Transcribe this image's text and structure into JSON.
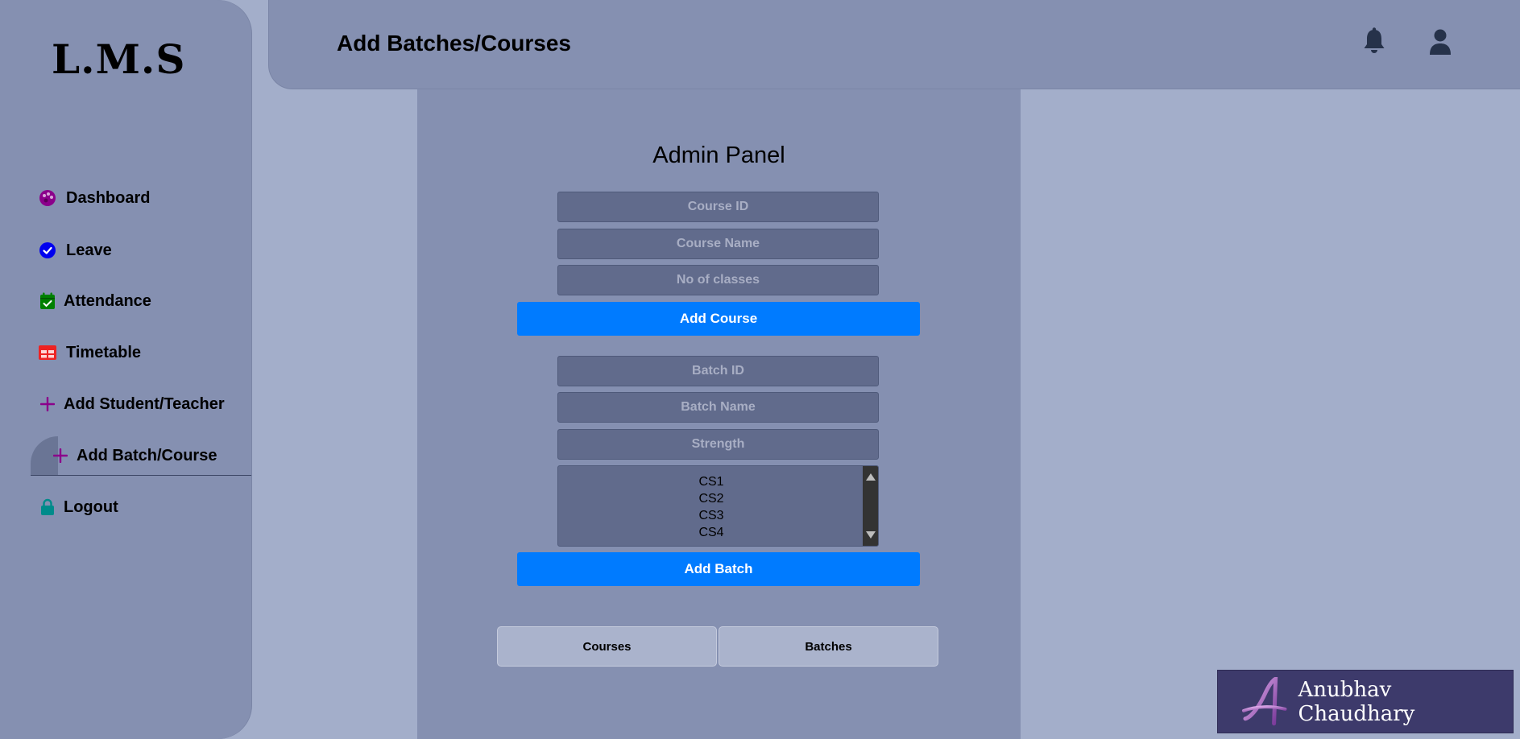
{
  "app": {
    "logo": "L.M.S"
  },
  "header": {
    "title": "Add Batches/Courses",
    "icons": [
      "bell-icon",
      "user-icon"
    ]
  },
  "sidebar": {
    "items": [
      {
        "label": "Dashboard",
        "icon": "palette-icon",
        "color": "#8b008b"
      },
      {
        "label": "Leave",
        "icon": "check-circle-icon",
        "color": "#0000ee"
      },
      {
        "label": "Attendance",
        "icon": "calendar-check-icon",
        "color": "#008000"
      },
      {
        "label": "Timetable",
        "icon": "table-icon",
        "color": "#ee2222"
      },
      {
        "label": "Add Student/Teacher",
        "icon": "plus-icon",
        "color": "#8b008b"
      },
      {
        "label": "Add Batch/Course",
        "icon": "plus-icon",
        "color": "#8b008b",
        "active": true
      },
      {
        "label": "Logout",
        "icon": "lock-icon",
        "color": "#008b8b"
      }
    ]
  },
  "panel": {
    "title": "Admin Panel",
    "course_form": {
      "course_id_placeholder": "Course ID",
      "course_name_placeholder": "Course Name",
      "classes_placeholder": "No of classes",
      "submit_label": "Add Course"
    },
    "batch_form": {
      "batch_id_placeholder": "Batch ID",
      "batch_name_placeholder": "Batch Name",
      "strength_placeholder": "Strength",
      "course_options": [
        "CS1",
        "CS2",
        "CS3",
        "CS4"
      ],
      "submit_label": "Add Batch"
    },
    "view_buttons": {
      "courses": "Courses",
      "batches": "Batches"
    }
  },
  "watermark": {
    "mark": "A",
    "name": "Anubhav Chaudhary"
  },
  "colors": {
    "background": "#a3aeca",
    "surface": "#8590b1",
    "input": "#616b8c",
    "primary": "#007bff"
  }
}
